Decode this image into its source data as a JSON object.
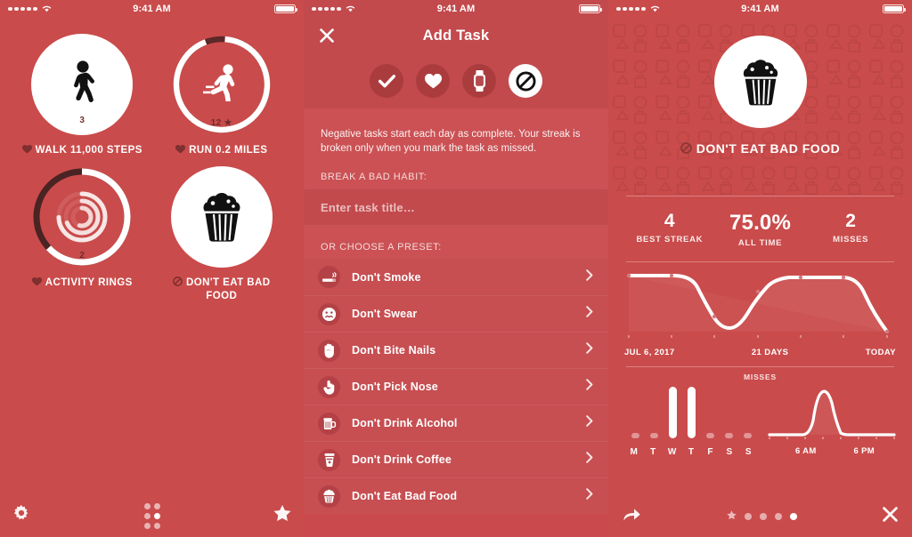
{
  "theme": {
    "bg": "#ca4b4b",
    "bg_dark": "#c24a4d",
    "bg_light": "#cb5154",
    "accent": "#ffffff",
    "dark_text": "#7b3030"
  },
  "status_bar": {
    "time": "9:41 AM",
    "signal_dots": 5,
    "wifi": "wifi-icon",
    "battery": "battery-icon"
  },
  "panel1": {
    "habits": [
      {
        "id": "walk",
        "icon": "walking-person-icon",
        "style": "solid",
        "count": "3",
        "label": "WALK 11,000 STEPS",
        "prefix_icon": "heart-icon",
        "progress": 1.0
      },
      {
        "id": "run",
        "icon": "running-person-icon",
        "style": "ring",
        "count": "12",
        "count_suffix": "star-icon",
        "label": "RUN 0.2 MILES",
        "prefix_icon": "heart-icon",
        "progress": 0.93
      },
      {
        "id": "rings",
        "icon": "activity-rings-icon",
        "style": "ring",
        "count": "2",
        "label": "ACTIVITY RINGS",
        "prefix_icon": "heart-icon",
        "progress": 0.63
      },
      {
        "id": "food",
        "icon": "cupcake-icon",
        "style": "solid",
        "count": "",
        "label": "DON'T EAT BAD FOOD",
        "prefix_icon": "no-entry-icon",
        "progress": 1.0
      }
    ],
    "toolbar": {
      "settings": {
        "name": "gear-icon",
        "label": "Settings"
      },
      "grid": {
        "name": "grid-dots-icon",
        "label": "All Tasks"
      },
      "star": {
        "name": "star-icon",
        "label": "Favorites"
      }
    }
  },
  "panel2": {
    "nav": {
      "title": "Add Task",
      "close": "close-icon"
    },
    "type_buttons": [
      {
        "id": "checkmark",
        "icon": "checkmark-icon",
        "active": false
      },
      {
        "id": "heart",
        "icon": "heart-icon",
        "active": false
      },
      {
        "id": "watch",
        "icon": "apple-watch-icon",
        "active": false
      },
      {
        "id": "negative",
        "icon": "no-entry-icon",
        "active": true
      }
    ],
    "description": "Negative tasks start each day as complete. Your streak is broken only when you mark the task as missed.",
    "section_habit": "BREAK A BAD HABIT:",
    "input": {
      "value": "",
      "placeholder": "Enter task title…"
    },
    "section_preset": "OR CHOOSE A PRESET:",
    "presets": [
      {
        "label": "Don't Smoke",
        "icon": "cigarette-icon"
      },
      {
        "label": "Don't Swear",
        "icon": "swearing-face-icon"
      },
      {
        "label": "Don't Bite Nails",
        "icon": "hand-icon"
      },
      {
        "label": "Don't Pick Nose",
        "icon": "pointing-finger-icon"
      },
      {
        "label": "Don't Drink Alcohol",
        "icon": "beer-mug-icon"
      },
      {
        "label": "Don't Drink Coffee",
        "icon": "coffee-cup-icon"
      },
      {
        "label": "Don't Eat Bad Food",
        "icon": "cupcake-icon"
      }
    ],
    "chevron": "chevron-right-icon"
  },
  "panel3": {
    "hero": {
      "icon": "cupcake-icon",
      "prefix_icon": "no-entry-icon",
      "title": "DON'T EAT BAD FOOD"
    },
    "stats": [
      {
        "value": "4",
        "label": "BEST STREAK"
      },
      {
        "value": "75.0%",
        "label": "ALL TIME"
      },
      {
        "value": "2",
        "label": "MISSES"
      }
    ],
    "graph_labels": {
      "start": "JUL 6, 2017",
      "middle": "21 DAYS",
      "end": "TODAY"
    },
    "misses_title": "MISSES",
    "week_days": [
      "M",
      "T",
      "W",
      "T",
      "F",
      "S",
      "S"
    ],
    "time_labels": {
      "morning": "6 AM",
      "evening": "6 PM"
    },
    "toolbar": {
      "share": {
        "name": "share-arrow-icon",
        "label": "Share"
      },
      "close": {
        "name": "close-icon",
        "label": "Close"
      },
      "pages": [
        {
          "type": "star",
          "active": false
        },
        {
          "type": "dot",
          "active": false
        },
        {
          "type": "dot",
          "active": false
        },
        {
          "type": "dot",
          "active": false
        },
        {
          "type": "dot",
          "active": true
        }
      ]
    }
  },
  "chart_data": [
    {
      "type": "line",
      "id": "streak-history",
      "title": "Completion history",
      "x": [
        "JUL 6, 2017",
        "",
        "",
        "21 DAYS",
        "",
        "",
        "TODAY"
      ],
      "values": [
        100,
        100,
        100,
        0,
        100,
        100,
        0
      ],
      "xlabel": "",
      "ylabel": "",
      "ylim": [
        0,
        100
      ],
      "grid": false,
      "legend": "none",
      "ticks": 7
    },
    {
      "type": "bar",
      "id": "misses-by-weekday",
      "title": "MISSES",
      "categories": [
        "M",
        "T",
        "W",
        "T",
        "F",
        "S",
        "S"
      ],
      "values": [
        0,
        0,
        1,
        1,
        0,
        0,
        0
      ],
      "xlabel": "",
      "ylabel": "",
      "ylim": [
        0,
        1
      ]
    },
    {
      "type": "line",
      "id": "misses-by-time-of-day",
      "title": "MISSES",
      "x": [
        "12 AM",
        "3 AM",
        "6 AM",
        "9 AM",
        "12 PM",
        "3 PM",
        "6 PM",
        "9 PM"
      ],
      "values": [
        0,
        0,
        95,
        5,
        0,
        0,
        0,
        0
      ],
      "xlabel": "",
      "ylabel": "",
      "ylim": [
        0,
        100
      ],
      "tick_labels": [
        "6 AM",
        "6 PM"
      ]
    }
  ]
}
